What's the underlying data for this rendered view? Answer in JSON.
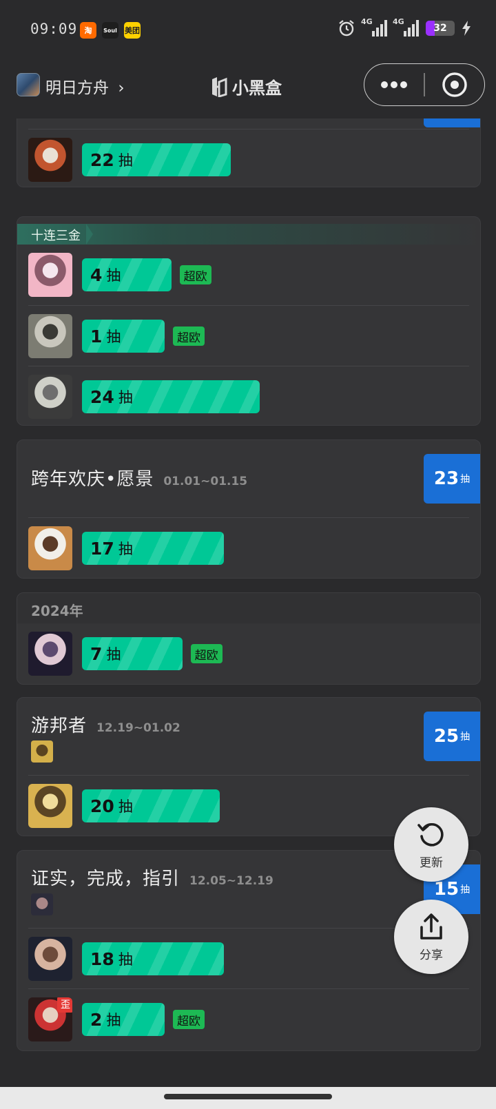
{
  "status": {
    "time": "09:09",
    "apps": [
      {
        "label": "淘",
        "bg": "#ff6a00",
        "fg": "#ffffff"
      },
      {
        "label": "Soul",
        "bg": "#1e1e1e",
        "fg": "#ffffff"
      },
      {
        "label": "美团",
        "bg": "#ffd100",
        "fg": "#222222"
      }
    ],
    "network1": "4G",
    "network2": "4G",
    "battery": "32",
    "battery_level": 0.32
  },
  "nav": {
    "game_name": "明日方舟",
    "chevron": "›",
    "title": "小黑盒"
  },
  "colors": {
    "pull_bar": "#00c896",
    "count_box": "#1a6fd6",
    "ou_tag": "#1db954"
  },
  "cards": [
    {
      "rows": [
        {
          "pulls": "22",
          "unit": "抽",
          "fill": 0.45,
          "avatar": [
            "#2b1a14",
            "#c2552f",
            "#e9e0d5"
          ]
        }
      ]
    },
    {
      "tag": "十连三金",
      "rows": [
        {
          "pulls": "4",
          "unit": "抽",
          "fill": 0.18,
          "badge": "超欧",
          "avatar": [
            "#f2b6c6",
            "#8b5a6a",
            "#f5e6ee"
          ]
        },
        {
          "pulls": "1",
          "unit": "抽",
          "fill": 0.15,
          "badge": "超欧",
          "avatar": [
            "#7c7c72",
            "#c9c7bd",
            "#3a3a35"
          ]
        },
        {
          "pulls": "24",
          "unit": "抽",
          "fill": 0.58,
          "avatar": [
            "#3b3b3b",
            "#cfd0c8",
            "#6e6e6e"
          ]
        }
      ]
    },
    {
      "banner": {
        "title": "跨年欢庆•愿景",
        "date": "01.01~01.15",
        "total": "23",
        "unit": "抽"
      },
      "rows": [
        {
          "pulls": "17",
          "unit": "抽",
          "fill": 0.42,
          "avatar": [
            "#c98a48",
            "#f1efe9",
            "#5b3b27"
          ]
        }
      ]
    },
    {
      "year": "2024年",
      "rows": [
        {
          "pulls": "7",
          "unit": "抽",
          "fill": 0.23,
          "badge": "超欧",
          "avatar": [
            "#1f1b2e",
            "#e0c9d4",
            "#5c4a6f"
          ]
        }
      ]
    },
    {
      "banner": {
        "title": "游邦者",
        "date": "12.19~01.02",
        "total": "25",
        "unit": "抽"
      },
      "mini_avatar": [
        "#d4b04a",
        "#5a4420"
      ],
      "rows": [
        {
          "pulls": "20",
          "unit": "抽",
          "fill": 0.4,
          "avatar": [
            "#d9b250",
            "#5b4524",
            "#f0dc9c"
          ]
        }
      ]
    },
    {
      "banner": {
        "title": "证实，完成，指引",
        "date": "12.05~12.19",
        "total": "15",
        "unit": "抽"
      },
      "mini_avatar": [
        "#2c2c3a",
        "#a88"
      ],
      "rows": [
        {
          "pulls": "18",
          "unit": "抽",
          "fill": 0.42,
          "avatar": [
            "#1e2230",
            "#d7b4a0",
            "#6d4b3b"
          ]
        },
        {
          "pulls": "2",
          "unit": "抽",
          "fill": 0.15,
          "badge": "超欧",
          "avatar": [
            "#2a1a1a",
            "#c33",
            "#e6d0c0"
          ],
          "corner": "歪"
        }
      ]
    }
  ],
  "fabs": {
    "refresh_label": "更新",
    "share_label": "分享"
  }
}
